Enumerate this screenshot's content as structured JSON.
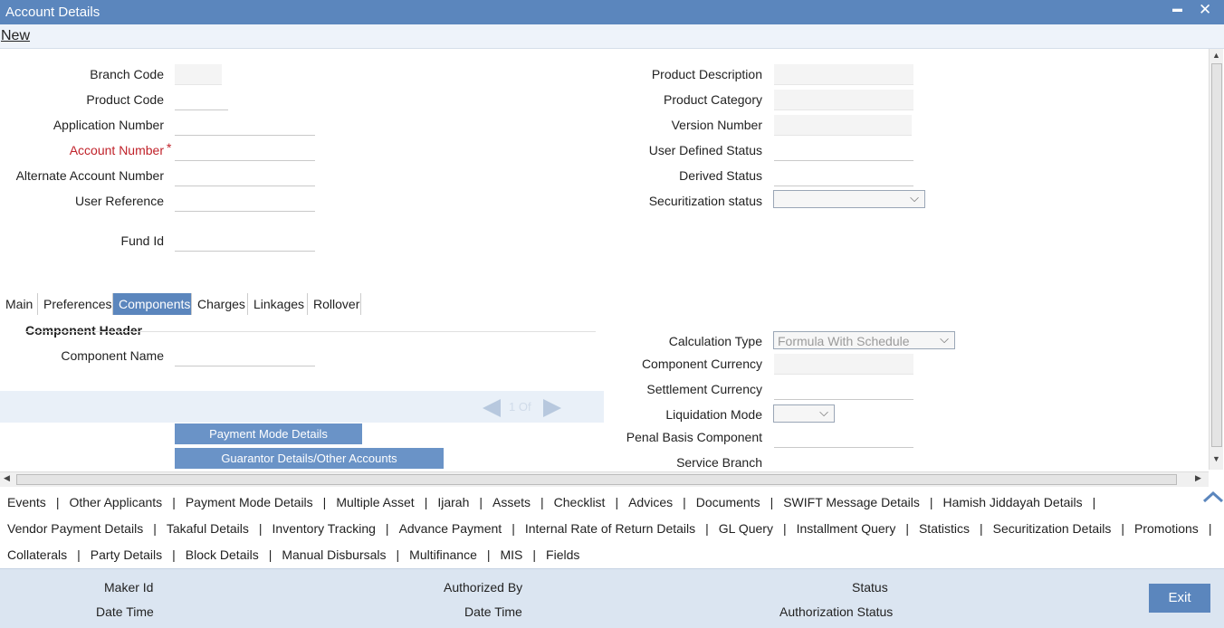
{
  "window": {
    "title": "Account Details",
    "minimize_glyph": "▬",
    "close_glyph": "✕"
  },
  "menu": {
    "new": "New"
  },
  "left_fields": {
    "branch_code": "Branch Code",
    "product_code": "Product Code",
    "application_number": "Application Number",
    "account_number": "Account Number",
    "account_number_required": "*",
    "alternate_account_number": "Alternate Account Number",
    "user_reference": "User Reference",
    "fund_id": "Fund Id"
  },
  "right_fields": {
    "product_description": "Product Description",
    "product_category": "Product Category",
    "version_number": "Version Number",
    "user_defined_status": "User Defined Status",
    "derived_status": "Derived Status",
    "securitization_status": "Securitization status"
  },
  "tabs": [
    "Main",
    "Preferences",
    "Components",
    "Charges",
    "Linkages",
    "Rollover"
  ],
  "active_tab": "Components",
  "component": {
    "header": "Component Header",
    "component_name": "Component Name",
    "pager": "1 Of",
    "payment_mode_details": "Payment Mode Details",
    "guarantor_details": "Guarantor Details/Other Accounts",
    "calculation_type": "Calculation Type",
    "calculation_type_value": "Formula With Schedule",
    "component_currency": "Component Currency",
    "settlement_currency": "Settlement Currency",
    "liquidation_mode": "Liquidation Mode",
    "penal_basis_component": "Penal Basis Component",
    "service_branch": "Service Branch"
  },
  "link_rows": [
    [
      "Events",
      "Other Applicants",
      "Payment Mode Details",
      "Multiple Asset",
      "Ijarah",
      "Assets",
      "Checklist",
      "Advices",
      "Documents",
      "SWIFT Message Details",
      "Hamish Jiddayah Details",
      ""
    ],
    [
      "Vendor Payment Details",
      "Takaful Details",
      "Inventory Tracking",
      "Advance Payment",
      "Internal Rate of Return Details",
      "GL Query",
      "Installment Query",
      "Statistics",
      "Securitization Details",
      "Promotions",
      ""
    ],
    [
      "Collaterals",
      "Party Details",
      "Block Details",
      "Manual Disbursals",
      "Multifinance",
      "MIS",
      "Fields"
    ]
  ],
  "footer": {
    "maker_id": "Maker Id",
    "date_time_1": "Date Time",
    "authorized_by": "Authorized By",
    "date_time_2": "Date Time",
    "status": "Status",
    "authorization_status": "Authorization Status",
    "exit": "Exit"
  },
  "colors": {
    "primary": "#5b86bd",
    "required": "#c0222a",
    "footer_bg": "#dbe5f1"
  }
}
